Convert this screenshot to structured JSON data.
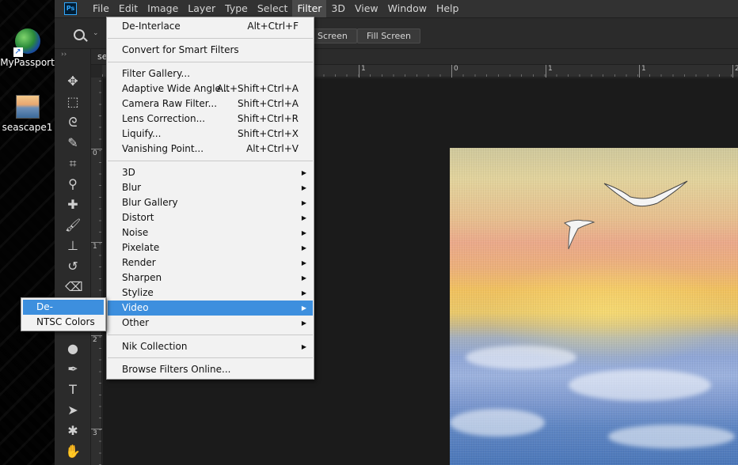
{
  "desktop": {
    "icons": [
      {
        "label": "MyPassport"
      },
      {
        "label": "seascape1"
      }
    ]
  },
  "menubar": {
    "logo": "Ps",
    "items": [
      "File",
      "Edit",
      "Image",
      "Layer",
      "Type",
      "Select",
      "Filter",
      "3D",
      "View",
      "Window",
      "Help"
    ],
    "active": "Filter"
  },
  "options": {
    "screen_label": "Screen",
    "fill_screen_label": "Fill Screen"
  },
  "document": {
    "tab_label": "se",
    "hruler_labels": [
      "1",
      "0",
      "1",
      "1",
      "2"
    ],
    "vruler_labels": [
      "0",
      "1",
      "2",
      "3"
    ]
  },
  "filter_menu": {
    "items": [
      {
        "label": "De-Interlace",
        "shortcut": "Alt+Ctrl+F"
      },
      {
        "label": "Convert for Smart Filters",
        "shortcut": ""
      },
      {
        "label": "Filter Gallery...",
        "shortcut": ""
      },
      {
        "label": "Adaptive Wide Angle...",
        "shortcut": "Alt+Shift+Ctrl+A"
      },
      {
        "label": "Camera Raw Filter...",
        "shortcut": "Shift+Ctrl+A"
      },
      {
        "label": "Lens Correction...",
        "shortcut": "Shift+Ctrl+R"
      },
      {
        "label": "Liquify...",
        "shortcut": "Shift+Ctrl+X"
      },
      {
        "label": "Vanishing Point...",
        "shortcut": "Alt+Ctrl+V"
      },
      {
        "label": "3D",
        "submenu": true
      },
      {
        "label": "Blur",
        "submenu": true
      },
      {
        "label": "Blur Gallery",
        "submenu": true
      },
      {
        "label": "Distort",
        "submenu": true
      },
      {
        "label": "Noise",
        "submenu": true
      },
      {
        "label": "Pixelate",
        "submenu": true
      },
      {
        "label": "Render",
        "submenu": true
      },
      {
        "label": "Sharpen",
        "submenu": true
      },
      {
        "label": "Stylize",
        "submenu": true
      },
      {
        "label": "Video",
        "submenu": true,
        "highlighted": true
      },
      {
        "label": "Other",
        "submenu": true
      },
      {
        "label": "Nik Collection",
        "submenu": true
      },
      {
        "label": "Browse Filters Online..."
      }
    ]
  },
  "video_submenu": {
    "items": [
      {
        "label": "De-Interlace...",
        "highlighted": true
      },
      {
        "label": "NTSC Colors"
      }
    ]
  },
  "colors": {
    "highlight": "#3d8fde",
    "menubar_bg": "#323232",
    "menu_bg": "#f2f2f2"
  }
}
